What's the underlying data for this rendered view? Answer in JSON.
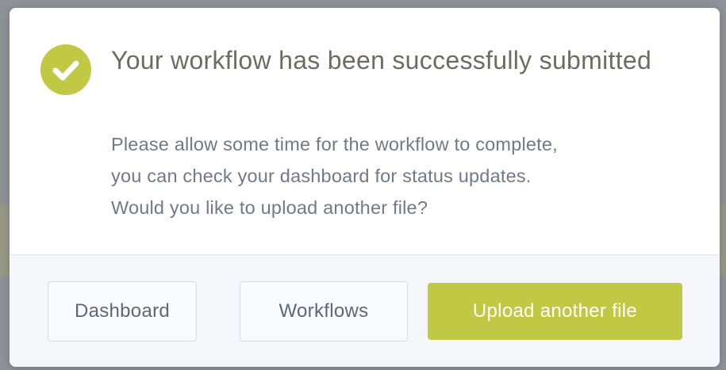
{
  "dialog": {
    "title": "Your workflow has been successfully submitted",
    "message_lines": [
      "Please allow some time for the workflow to complete,",
      "you can check your dashboard for status updates.",
      "Would you like to upload another file?"
    ],
    "icon": "check-circle-icon"
  },
  "actions": {
    "dashboard_label": "Dashboard",
    "workflows_label": "Workflows",
    "upload_label": "Upload another file"
  },
  "colors": {
    "accent": "#c1c844",
    "title": "#6f6b60",
    "text": "#707987",
    "overlay": "#8e9196"
  }
}
